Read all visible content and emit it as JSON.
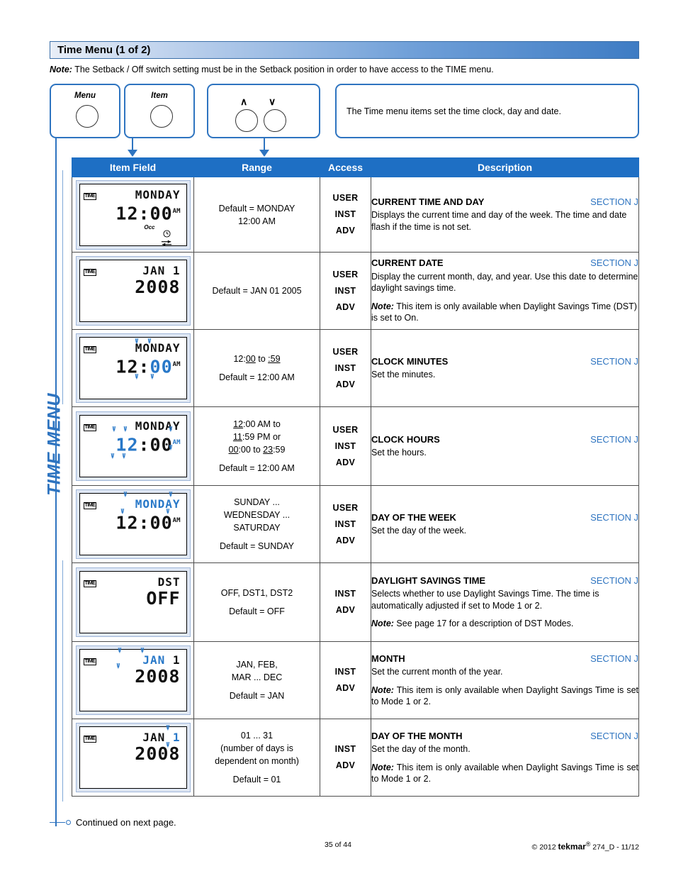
{
  "header": {
    "title": "Time Menu (1 of 2)",
    "note_label": "Note:",
    "note_text": " The Setback / Off switch setting must be in the Setback position in order to have access to the TIME menu.",
    "accent_color": "#2e74c0",
    "header_bg": "#1e6fc4"
  },
  "controls": {
    "menu_button": "Menu",
    "item_button": "Item",
    "up_arrow": "∧",
    "down_arrow": "∨",
    "description": "The Time menu items set the time clock, day and date."
  },
  "side_label": "TIME MENU",
  "table": {
    "columns": [
      "Item Field",
      "Range",
      "Access",
      "Description"
    ],
    "rows": [
      {
        "lcd": {
          "badge": "TIME",
          "line1": "MONDAY",
          "line2": "12:00",
          "ampm": "AM",
          "occ": "Occ",
          "clock_icon": true,
          "flow_icon": true
        },
        "range": [
          "Default = MONDAY",
          "12:00 AM"
        ],
        "access": [
          "USER",
          "INST",
          "ADV"
        ],
        "title": "CURRENT TIME AND DAY",
        "section": "SECTION J",
        "body": "Displays the current time and day of the week. The time and date flash if the time is not set.",
        "note_label": "",
        "note": ""
      },
      {
        "lcd": {
          "badge": "TIME",
          "line1": "JAN    1",
          "line2": "2008",
          "ampm": "",
          "occ": "",
          "clock_icon": false,
          "flow_icon": false
        },
        "range": [
          "Default = JAN 01 2005"
        ],
        "access": [
          "USER",
          "INST",
          "ADV"
        ],
        "title": "CURRENT DATE",
        "section": "SECTION J",
        "body": "Display the current month, day, and year. Use this date to determine daylight savings time.",
        "note_label": "Note:",
        "note": " This item is only available when Daylight Savings Time (DST) is set to On."
      },
      {
        "lcd": {
          "badge": "TIME",
          "line1": "MONDAY",
          "line2_pre": "12:",
          "line2_hl": "00",
          "ampm": "AM",
          "occ": "",
          "clock_icon": false,
          "flow_icon": false
        },
        "range": [
          "12:00 to :59",
          "Default = 12:00 AM"
        ],
        "access": [
          "USER",
          "INST",
          "ADV"
        ],
        "title": "CLOCK MINUTES",
        "section": "SECTION J",
        "body": "Set the minutes.",
        "note_label": "",
        "note": ""
      },
      {
        "lcd": {
          "badge": "TIME",
          "line1": "MONDAY",
          "line2_hl": "12",
          "line2_post": ":00",
          "ampm": "AM",
          "ampm_hl": true,
          "occ": "",
          "clock_icon": false,
          "flow_icon": false
        },
        "range": [
          "12:00 AM to",
          "11:59 PM or",
          "00:00 to 23:59",
          "Default = 12:00 AM"
        ],
        "access": [
          "USER",
          "INST",
          "ADV"
        ],
        "title": "CLOCK HOURS",
        "section": "SECTION J",
        "body": "Set the hours.",
        "note_label": "",
        "note": ""
      },
      {
        "lcd": {
          "badge": "TIME",
          "line1_hl": "MONDAY",
          "line2": "12:00",
          "ampm": "AM",
          "occ": "",
          "clock_icon": false,
          "flow_icon": false
        },
        "range": [
          "SUNDAY ...",
          "WEDNESDAY ...",
          "SATURDAY",
          "Default = SUNDAY"
        ],
        "access": [
          "USER",
          "INST",
          "ADV"
        ],
        "title": "DAY OF THE WEEK",
        "section": "SECTION J",
        "body": "Set the day of the week.",
        "note_label": "",
        "note": ""
      },
      {
        "lcd": {
          "badge": "TIME",
          "line1": "DST",
          "line2": "OFF",
          "ampm": "",
          "occ": "",
          "clock_icon": false,
          "flow_icon": false
        },
        "range": [
          "OFF, DST1, DST2",
          "Default = OFF"
        ],
        "access": [
          "INST",
          "ADV"
        ],
        "title": "DAYLIGHT SAVINGS TIME",
        "section": "SECTION J",
        "body": "Selects whether to use Daylight Savings Time. The time is automatically adjusted if set to Mode 1 or 2.",
        "note_label": "Note:",
        "note": " See page 17 for a description of DST Modes."
      },
      {
        "lcd": {
          "badge": "TIME",
          "line1_hl": "JAN",
          "line1_post": "    1",
          "line2": "2008",
          "ampm": "",
          "occ": "",
          "clock_icon": false,
          "flow_icon": false
        },
        "range": [
          "JAN, FEB,",
          "MAR ... DEC",
          "Default = JAN"
        ],
        "access": [
          "INST",
          "ADV"
        ],
        "title": "MONTH",
        "section": "SECTION J",
        "body": "Set the current month of the year.",
        "note_label": "Note:",
        "note": " This item is only available when Daylight Savings Time is set to Mode 1 or 2."
      },
      {
        "lcd": {
          "badge": "TIME",
          "line1": "JAN    ",
          "line1_hl_tail": "1",
          "line2": "2008",
          "ampm": "",
          "occ": "",
          "clock_icon": false,
          "flow_icon": false
        },
        "range": [
          "01 ... 31",
          "(number of days is",
          "dependent on month)",
          "Default = 01"
        ],
        "access": [
          "INST",
          "ADV"
        ],
        "title": "DAY OF THE MONTH",
        "section": "SECTION J",
        "body": "Set the day of the month.",
        "note_label": "Note:",
        "note": " This item is only available when Daylight Savings Time is set to Mode 1 or 2."
      }
    ]
  },
  "footer": {
    "continued": "Continued on next page.",
    "page": "35 of 44",
    "copyright": "© 2012",
    "brand": "tekmar",
    "brand_sup": "®",
    "doc": "274_D - 11/12"
  }
}
